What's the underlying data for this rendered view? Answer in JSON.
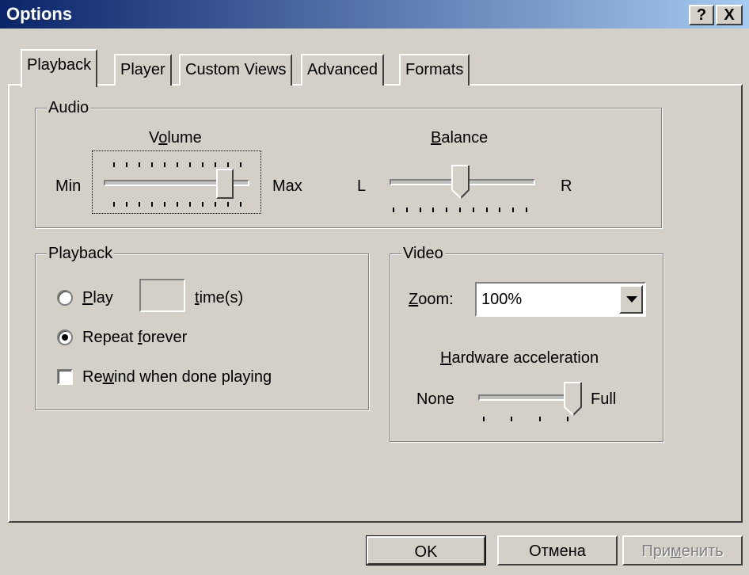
{
  "window": {
    "title": "Options",
    "help_button": "?",
    "close_button": "X",
    "title_gradient_start": "#0a246a",
    "title_gradient_end": "#a6caf0"
  },
  "tabs": [
    {
      "label": "Playback",
      "selected": true
    },
    {
      "label": "Player",
      "selected": false
    },
    {
      "label": "Custom Views",
      "selected": false
    },
    {
      "label": "Advanced",
      "selected": false
    },
    {
      "label": "Formats",
      "selected": false
    }
  ],
  "audio": {
    "group_label": "Audio",
    "volume": {
      "label_pre": "V",
      "label_accel": "o",
      "label_post": "lume",
      "min_label": "Min",
      "max_label": "Max",
      "level": 0.85
    },
    "balance": {
      "label_accel": "B",
      "label_post": "alance",
      "left_label": "L",
      "right_label": "R",
      "level": 0.5
    }
  },
  "playback": {
    "group_label": "Playback",
    "play_option": {
      "accel": "P",
      "label_post": "lay",
      "selected": false,
      "times_value": ""
    },
    "times_label": {
      "accel": "t",
      "label_post": "ime(s)"
    },
    "repeat_option": {
      "label_pre": "Repeat ",
      "accel": "f",
      "label_post": "orever",
      "selected": true
    },
    "rewind_option": {
      "label_pre": "Re",
      "accel": "w",
      "label_post": "ind when done playing",
      "checked": false
    }
  },
  "video": {
    "group_label": "Video",
    "zoom_label": {
      "accel": "Z",
      "label_post": "oom:"
    },
    "zoom_value": "100%",
    "hw_label": {
      "accel": "H",
      "label_post": "ardware acceleration"
    },
    "hw_none": "None",
    "hw_full": "Full",
    "hw_level": 1.0
  },
  "buttons": {
    "ok": "OK",
    "cancel": "Отмена",
    "apply_pre": "При",
    "apply_accel": "м",
    "apply_post": "енить"
  }
}
